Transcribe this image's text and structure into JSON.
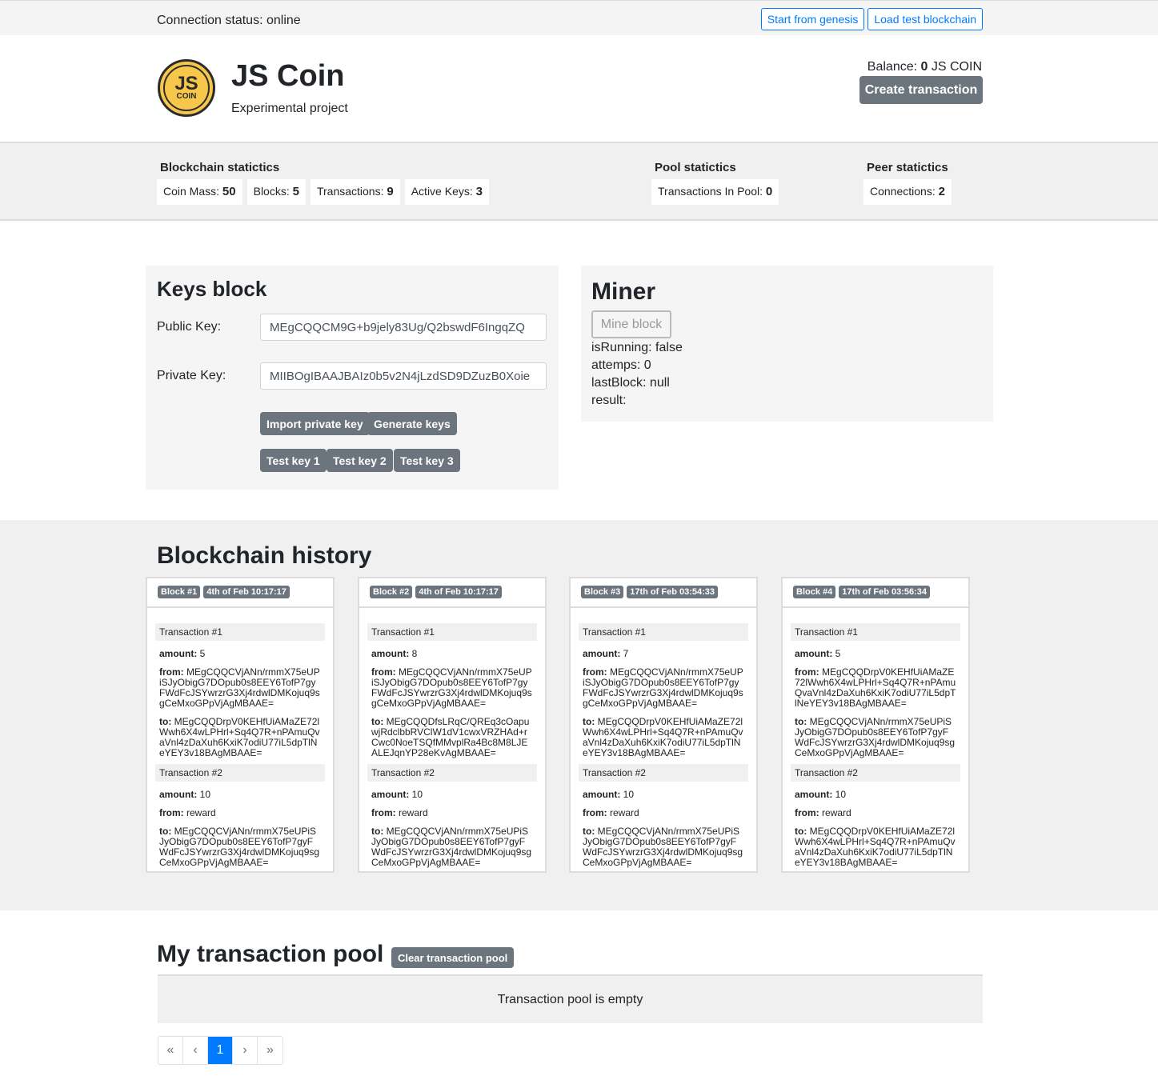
{
  "topbar": {
    "connection": "Connection status: online",
    "start_genesis": "Start from genesis",
    "load_test": "Load test blockchain"
  },
  "header": {
    "logo_js": "JS",
    "logo_coin": "COIN",
    "title": "JS Coin",
    "subtitle": "Experimental project",
    "balance_label": "Balance:",
    "balance_value": "0",
    "balance_unit": "JS COIN",
    "create_tx": "Create transaction"
  },
  "stats": {
    "blockchain": {
      "title": "Blockchain statictics",
      "coin_mass_label": "Coin Mass:",
      "coin_mass": "50",
      "blocks_label": "Blocks:",
      "blocks": "5",
      "transactions_label": "Transactions:",
      "transactions": "9",
      "active_keys_label": "Active Keys:",
      "active_keys": "3"
    },
    "pool": {
      "title": "Pool statictics",
      "in_pool_label": "Transactions In Pool:",
      "in_pool": "0"
    },
    "peer": {
      "title": "Peer statictics",
      "connections_label": "Connections:",
      "connections": "2"
    }
  },
  "keys": {
    "title": "Keys block",
    "public_label": "Public Key:",
    "public_value": "MEgCQQCM9G+b9jely83Ug/Q2bswdF6IngqZQ",
    "private_label": "Private Key:",
    "private_value": "MIIBOgIBAAJBAIz0b5v2N4jLzdSD9DZuzB0Xoie",
    "import": "Import private key",
    "generate": "Generate keys",
    "test1": "Test key 1",
    "test2": "Test key 2",
    "test3": "Test key 3"
  },
  "miner": {
    "title": "Miner",
    "mine_btn": "Mine block",
    "is_running": "isRunning: false",
    "attemps": "attemps: 0",
    "last_block": "lastBlock: null",
    "result": "result:"
  },
  "history": {
    "title": "Blockchain history",
    "amount_label": "amount:",
    "from_label": "from:",
    "to_label": "to:",
    "blocks": [
      {
        "id": "Block #1",
        "date": "4th of Feb 10:17:17",
        "txs": [
          {
            "label": "Transaction #1",
            "amount": "5",
            "from": "MEgCQQCVjANn/rmmX75eUPiSJyObigG7DOpub0s8EEY6TofP7gyFWdFcJSYwrzrG3Xj4rdwlDMKojuq9sgCeMxoGPpVjAgMBAAE=",
            "to": "MEgCQQDrpV0KEHfUiAMaZE72lWwh6X4wLPHrl+Sq4Q7R+nPAmuQvaVnl4zDaXuh6KxiK7odiU77iL5dpTlNeYEY3v18BAgMBAAE="
          },
          {
            "label": "Transaction #2",
            "amount": "10",
            "from": "reward",
            "to": "MEgCQQCVjANn/rmmX75eUPiSJyObigG7DOpub0s8EEY6TofP7gyFWdFcJSYwrzrG3Xj4rdwlDMKojuq9sgCeMxoGPpVjAgMBAAE="
          }
        ]
      },
      {
        "id": "Block #2",
        "date": "4th of Feb 10:17:17",
        "txs": [
          {
            "label": "Transaction #1",
            "amount": "8",
            "from": "MEgCQQCVjANn/rmmX75eUPiSJyObigG7DOpub0s8EEY6TofP7gyFWdFcJSYwrzrG3Xj4rdwlDMKojuq9sgCeMxoGPpVjAgMBAAE=",
            "to": "MEgCQQDfsLRqC/QREq3cOapuwjRdclbbRVClW1dV1cwxVRZHAd+rCwc0NoeTSQfMMvplRa4Bc8M8LJEALEJqnYP28eKvAgMBAAE="
          },
          {
            "label": "Transaction #2",
            "amount": "10",
            "from": "reward",
            "to": "MEgCQQCVjANn/rmmX75eUPiSJyObigG7DOpub0s8EEY6TofP7gyFWdFcJSYwrzrG3Xj4rdwlDMKojuq9sgCeMxoGPpVjAgMBAAE="
          }
        ]
      },
      {
        "id": "Block #3",
        "date": "17th of Feb 03:54:33",
        "txs": [
          {
            "label": "Transaction #1",
            "amount": "7",
            "from": "MEgCQQCVjANn/rmmX75eUPiSJyObigG7DOpub0s8EEY6TofP7gyFWdFcJSYwrzrG3Xj4rdwlDMKojuq9sgCeMxoGPpVjAgMBAAE=",
            "to": "MEgCQQDrpV0KEHfUiAMaZE72lWwh6X4wLPHrl+Sq4Q7R+nPAmuQvaVnl4zDaXuh6KxiK7odiU77iL5dpTlNeYEY3v18BAgMBAAE="
          },
          {
            "label": "Transaction #2",
            "amount": "10",
            "from": "reward",
            "to": "MEgCQQCVjANn/rmmX75eUPiSJyObigG7DOpub0s8EEY6TofP7gyFWdFcJSYwrzrG3Xj4rdwlDMKojuq9sgCeMxoGPpVjAgMBAAE="
          }
        ]
      },
      {
        "id": "Block #4",
        "date": "17th of Feb 03:56:34",
        "txs": [
          {
            "label": "Transaction #1",
            "amount": "5",
            "from": "MEgCQQDrpV0KEHfUiAMaZE72lWwh6X4wLPHrl+Sq4Q7R+nPAmuQvaVnl4zDaXuh6KxiK7odiU77iL5dpTlNeYEY3v18BAgMBAAE=",
            "to": "MEgCQQCVjANn/rmmX75eUPiSJyObigG7DOpub0s8EEY6TofP7gyFWdFcJSYwrzrG3Xj4rdwlDMKojuq9sgCeMxoGPpVjAgMBAAE="
          },
          {
            "label": "Transaction #2",
            "amount": "10",
            "from": "reward",
            "to": "MEgCQQDrpV0KEHfUiAMaZE72lWwh6X4wLPHrl+Sq4Q7R+nPAmuQvaVnl4zDaXuh6KxiK7odiU77iL5dpTlNeYEY3v18BAgMBAAE="
          }
        ]
      }
    ]
  },
  "pool": {
    "title": "My transaction pool",
    "clear": "Clear transaction pool",
    "empty": "Transaction pool is empty",
    "pager": [
      "«",
      "‹",
      "1",
      "›",
      "»"
    ]
  }
}
